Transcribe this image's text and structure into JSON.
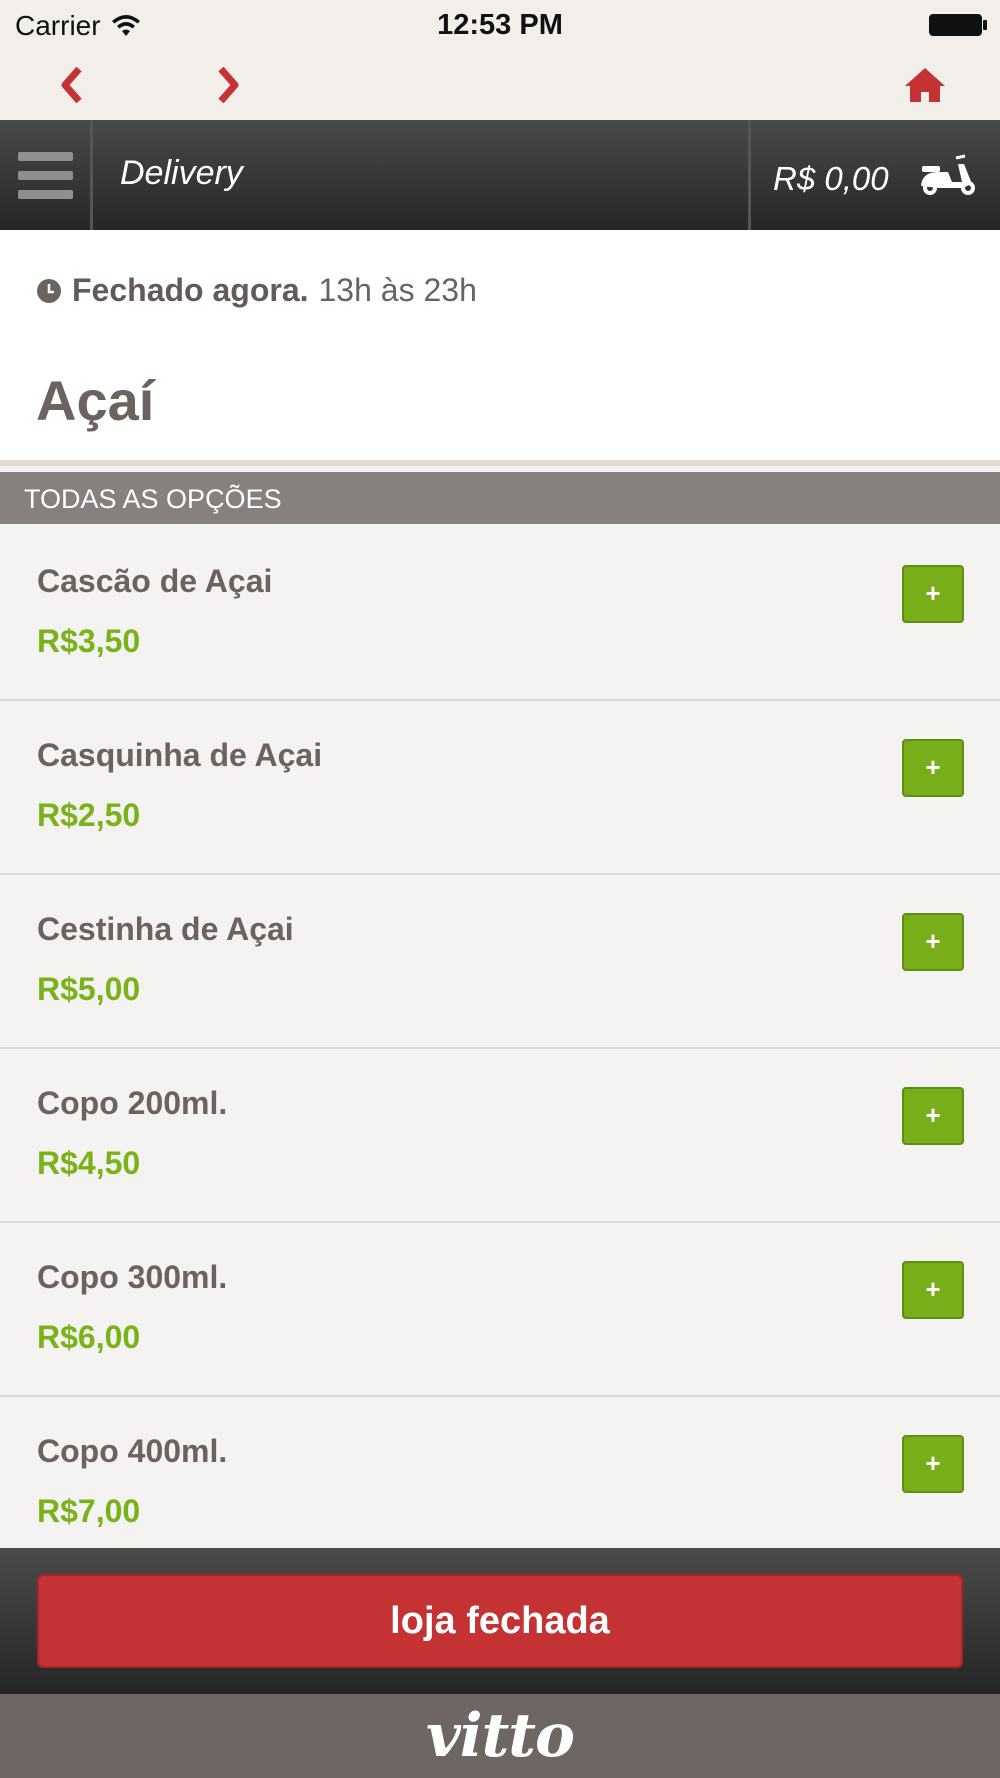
{
  "status_bar": {
    "carrier": "Carrier",
    "time": "12:53 PM"
  },
  "nav": {
    "back_icon": "chevron-left-icon",
    "forward_icon": "chevron-right-icon",
    "home_icon": "home-icon",
    "accent_color": "#c43233"
  },
  "header": {
    "title": "Delivery",
    "cart_total": "R$ 0,00",
    "cart_icon": "scooter-icon"
  },
  "store": {
    "status": "Fechado agora.",
    "hours": "13h às 23h",
    "category_title": "Açaí"
  },
  "section": {
    "label": "TODAS AS OPÇÕES"
  },
  "items": [
    {
      "name": "Cascão de Açai",
      "price": "R$3,50",
      "add_label": "+"
    },
    {
      "name": "Casquinha de Açai",
      "price": "R$2,50",
      "add_label": "+"
    },
    {
      "name": "Cestinha de Açai",
      "price": "R$5,00",
      "add_label": "+"
    },
    {
      "name": "Copo 200ml.",
      "price": "R$4,50",
      "add_label": "+"
    },
    {
      "name": "Copo 300ml.",
      "price": "R$6,00",
      "add_label": "+"
    },
    {
      "name": "Copo 400ml.",
      "price": "R$7,00",
      "add_label": "+"
    }
  ],
  "footer": {
    "button_label": "loja fechada",
    "brand": "vitto"
  },
  "colors": {
    "price_green": "#7ab21a",
    "button_green": "#78ae19",
    "closed_red": "#c43233",
    "text_brown": "#6b6360"
  }
}
